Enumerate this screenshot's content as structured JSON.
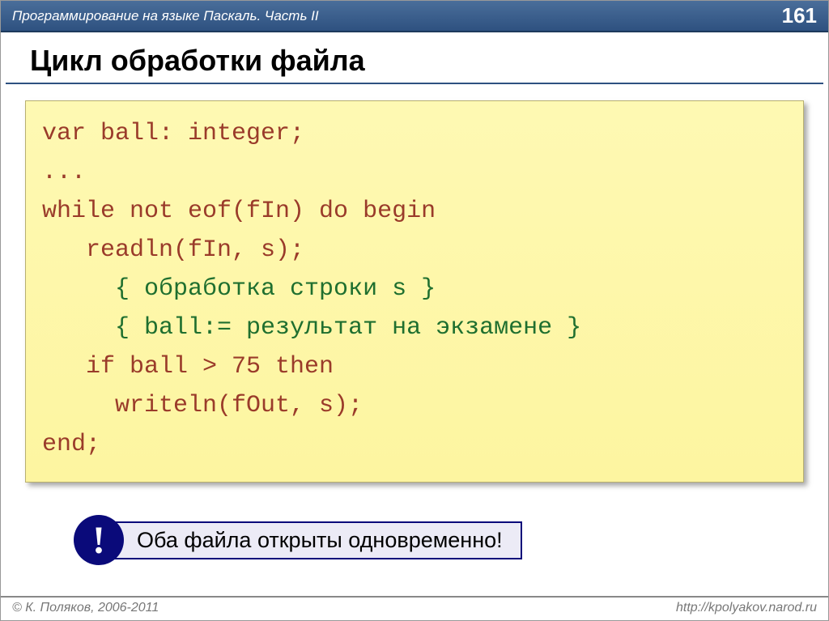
{
  "header": {
    "subject": "Программирование на языке Паскаль. Часть II",
    "page_number": "161"
  },
  "title": "Цикл обработки файла",
  "code": {
    "l1": "var ball: integer;",
    "l2": "...",
    "l3": "while not eof(fIn) do begin",
    "l4": "   readln(fIn, s);",
    "l5a": "     ",
    "l5b": "{ обработка строки s }",
    "l6a": "     ",
    "l6b": "{ ball:= результат на экзамене }",
    "l7": "   if ball > 75 then",
    "l8": "     writeln(fOut, s);",
    "l9": "end;"
  },
  "callout": {
    "icon": "!",
    "text": "Оба файла открыты одновременно!"
  },
  "footer": {
    "copyright": "© К. Поляков, 2006-2011",
    "url": "http://kpolyakov.narod.ru"
  }
}
